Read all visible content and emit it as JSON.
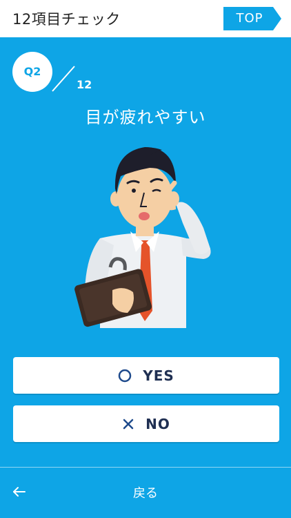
{
  "header": {
    "title": "12項目チェック",
    "top_label": "TOP"
  },
  "question": {
    "badge": "Q2",
    "total": "12",
    "text": "目が疲れやすい"
  },
  "answers": {
    "yes": {
      "label": "YES",
      "icon": "circle-icon"
    },
    "no": {
      "label": "NO",
      "icon": "cross-icon"
    }
  },
  "footer": {
    "back_label": "戻る",
    "back_icon": "arrow-left-icon"
  },
  "colors": {
    "accent": "#0ea5e6",
    "text_dark": "#1f2f52",
    "tie": "#e5532a"
  }
}
